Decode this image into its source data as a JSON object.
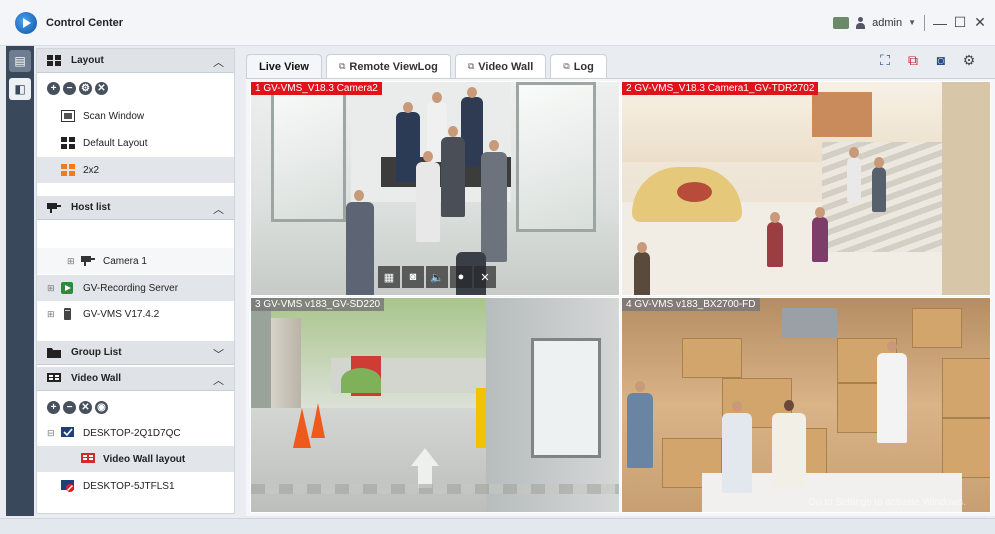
{
  "app": {
    "title": "Control Center"
  },
  "titlebar": {
    "user": "admin"
  },
  "sidebar": {
    "layout": {
      "header": "Layout",
      "items": [
        {
          "label": "Scan Window"
        },
        {
          "label": "Default Layout"
        },
        {
          "label": "2x2",
          "selected": true
        }
      ]
    },
    "host_list": {
      "header": "Host list",
      "items": [
        {
          "label": "Camera 1"
        },
        {
          "label": "GV-Recording Server"
        },
        {
          "label": "GV-VMS V17.4.2"
        }
      ]
    },
    "group_list": {
      "header": "Group List"
    },
    "video_wall": {
      "header": "Video Wall",
      "items": [
        {
          "label": "DESKTOP-2Q1D7QC"
        },
        {
          "label": "Video Wall layout",
          "selected": true
        },
        {
          "label": "DESKTOP-5JTFLS1"
        }
      ]
    }
  },
  "tabs": [
    {
      "label": "Live View",
      "active": true
    },
    {
      "label": "Remote ViewLog"
    },
    {
      "label": "Video Wall"
    },
    {
      "label": "Log"
    }
  ],
  "cameras": [
    {
      "label": "1 GV-VMS_V18.3 Camera2"
    },
    {
      "label": "2 GV-VMS_V18.3 Camera1_GV-TDR2702"
    },
    {
      "label": "3 GV-VMS v183_GV-SD220"
    },
    {
      "label": "4 GV-VMS v183_BX2700-FD"
    }
  ],
  "watermark": "Go to Settings to activate Windows.",
  "colors": {
    "camera_label_active": "#e0131b",
    "rail": "#39485a"
  }
}
